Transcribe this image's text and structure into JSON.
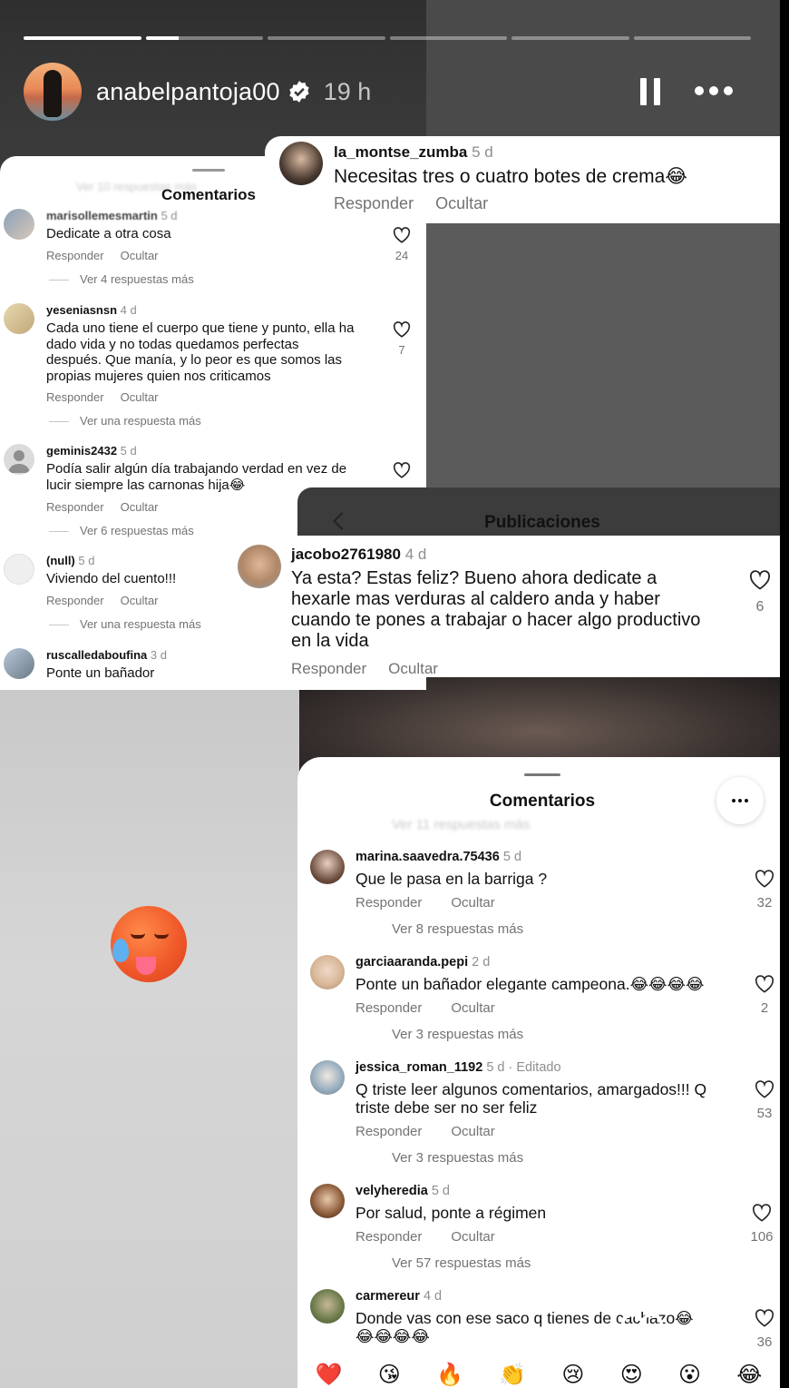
{
  "story": {
    "progress": [
      1.0,
      0.28,
      0,
      0,
      0,
      0
    ],
    "username": "anabelpantoja00",
    "time": "19 h",
    "emoji": "hot-face-sweat"
  },
  "left_panel": {
    "title": "Comentarios",
    "faded_top": "Ver 10 respuestas más",
    "comments": [
      {
        "user": "marisollemesmartin",
        "ago": "5 d",
        "text": "Dedicate a otra cosa",
        "reply": "Responder",
        "hide": "Ocultar",
        "more": "Ver 4 respuestas más",
        "likes": "24"
      },
      {
        "user": "yeseniasnsn",
        "ago": "4 d",
        "text": "Cada uno tiene el cuerpo que tiene y punto, ella ha\ndado vida y no todas quedamos perfectas\ndespués. Que manía, y lo peor es que somos las\npropias mujeres quien nos criticamos",
        "reply": "Responder",
        "hide": "Ocultar",
        "more": "Ver una respuesta más",
        "likes": "7"
      },
      {
        "user": "geminis2432",
        "ago": "5 d",
        "text": "Podía salir algún día trabajando verdad en vez de\nlucir siempre las carnonas hija😂",
        "reply": "Responder",
        "hide": "Ocultar",
        "more": "Ver 6 respuestas más",
        "likes": ""
      },
      {
        "user": "(null)",
        "ago": "5 d",
        "text": "Viviendo del cuento!!!",
        "reply": "Responder",
        "hide": "Ocultar",
        "more": "Ver una respuesta más",
        "likes": ""
      },
      {
        "user": "ruscalledaboufina",
        "ago": "3 d",
        "text": "Ponte un bañador",
        "reply": "",
        "hide": "",
        "more": "",
        "likes": ""
      }
    ]
  },
  "top_right": {
    "user": "la_montse_zumba",
    "ago": "5 d",
    "text": "Necesitas tres o cuatro botes de crema😂",
    "reply": "Responder",
    "hide": "Ocultar"
  },
  "publicaciones": {
    "title": "Publicaciones"
  },
  "mid_right": {
    "user": "jacobo2761980",
    "ago": "4 d",
    "text": "Ya esta? Estas feliz? Bueno ahora dedicate a\nhexarle mas verduras al caldero anda y haber\ncuando te pones a trabajar o hacer algo productivo\nen la vida",
    "reply": "Responder",
    "hide": "Ocultar",
    "likes": "6"
  },
  "right_panel": {
    "title": "Comentarios",
    "faded_top": "Ver 11 respuestas más",
    "comments": [
      {
        "user": "marina.saavedra.75436",
        "ago": "5 d",
        "text": "Que le pasa en la barriga ?",
        "reply": "Responder",
        "hide": "Ocultar",
        "more": "Ver 8 respuestas más",
        "likes": "32"
      },
      {
        "user": "garciaaranda.pepi",
        "ago": "2 d",
        "text": "Ponte un bañador elegante campeona.😂😂😂😂",
        "reply": "Responder",
        "hide": "Ocultar",
        "more": "Ver 3 respuestas más",
        "likes": "2"
      },
      {
        "user": "jessica_roman_1192",
        "ago": "5 d · Editado",
        "text": "Q triste leer algunos comentarios, amargados!!! Q\ntriste debe ser no ser feliz",
        "reply": "Responder",
        "hide": "Ocultar",
        "more": "Ver 3 respuestas más",
        "likes": "53"
      },
      {
        "user": "velyheredia",
        "ago": "5 d",
        "text": "Por salud, ponte a régimen",
        "reply": "Responder",
        "hide": "Ocultar",
        "more": "Ver 57 respuestas más",
        "likes": "106"
      },
      {
        "user": "carmereur",
        "ago": "4 d",
        "text": "Donde vas con ese saco q tienes de cachazo😂\n😂😂😂😂",
        "reply": "",
        "hide": "",
        "more": "",
        "likes": "36"
      }
    ],
    "reactions": [
      "❤️",
      "😘",
      "🔥",
      "👏",
      "😢",
      "😍",
      "😮",
      "😂"
    ]
  },
  "colors": {
    "accent": "#ffffff",
    "muted": "#737373",
    "like_gray": "#737373"
  }
}
